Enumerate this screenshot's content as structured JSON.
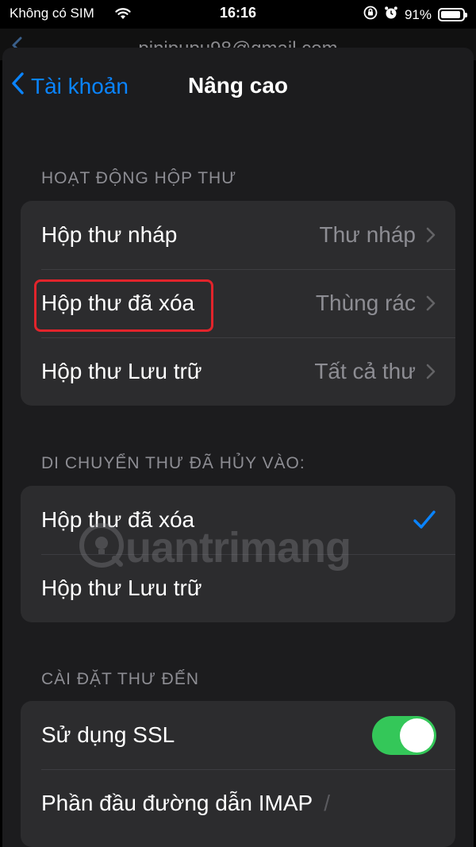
{
  "status_bar": {
    "carrier": "Không có SIM",
    "time": "16:16",
    "battery": "91%",
    "battery_level": 0.91
  },
  "background_page": {
    "title_fragment": "pinipupu98@gmail.com"
  },
  "nav": {
    "back_label": "Tài khoản",
    "title": "Nâng cao"
  },
  "sections": {
    "mailbox": {
      "header": "HOẠT ĐỘNG HỘP THƯ",
      "rows": [
        {
          "label": "Hộp thư nháp",
          "value": "Thư nháp"
        },
        {
          "label": "Hộp thư đã xóa",
          "value": "Thùng rác"
        },
        {
          "label": "Hộp thư Lưu trữ",
          "value": "Tất cả thư"
        }
      ]
    },
    "move_discarded": {
      "header": "DI CHUYỂN THƯ ĐÃ HỦY VÀO:",
      "rows": [
        {
          "label": "Hộp thư đã xóa",
          "checked": true
        },
        {
          "label": "Hộp thư Lưu trữ",
          "checked": false
        }
      ]
    },
    "incoming": {
      "header": "CÀI ĐẶT THƯ ĐẾN",
      "ssl_label": "Sử dụng SSL",
      "ssl_on": true,
      "imap_label": "Phần đầu đường dẫn IMAP",
      "imap_value": "/"
    }
  },
  "watermark": "uantrimang",
  "colors": {
    "accent": "#0a84ff",
    "toggle_on": "#34c759",
    "highlight": "#e2242b",
    "cell_bg": "#2c2c2e",
    "sheet_bg": "#1c1c1e"
  }
}
